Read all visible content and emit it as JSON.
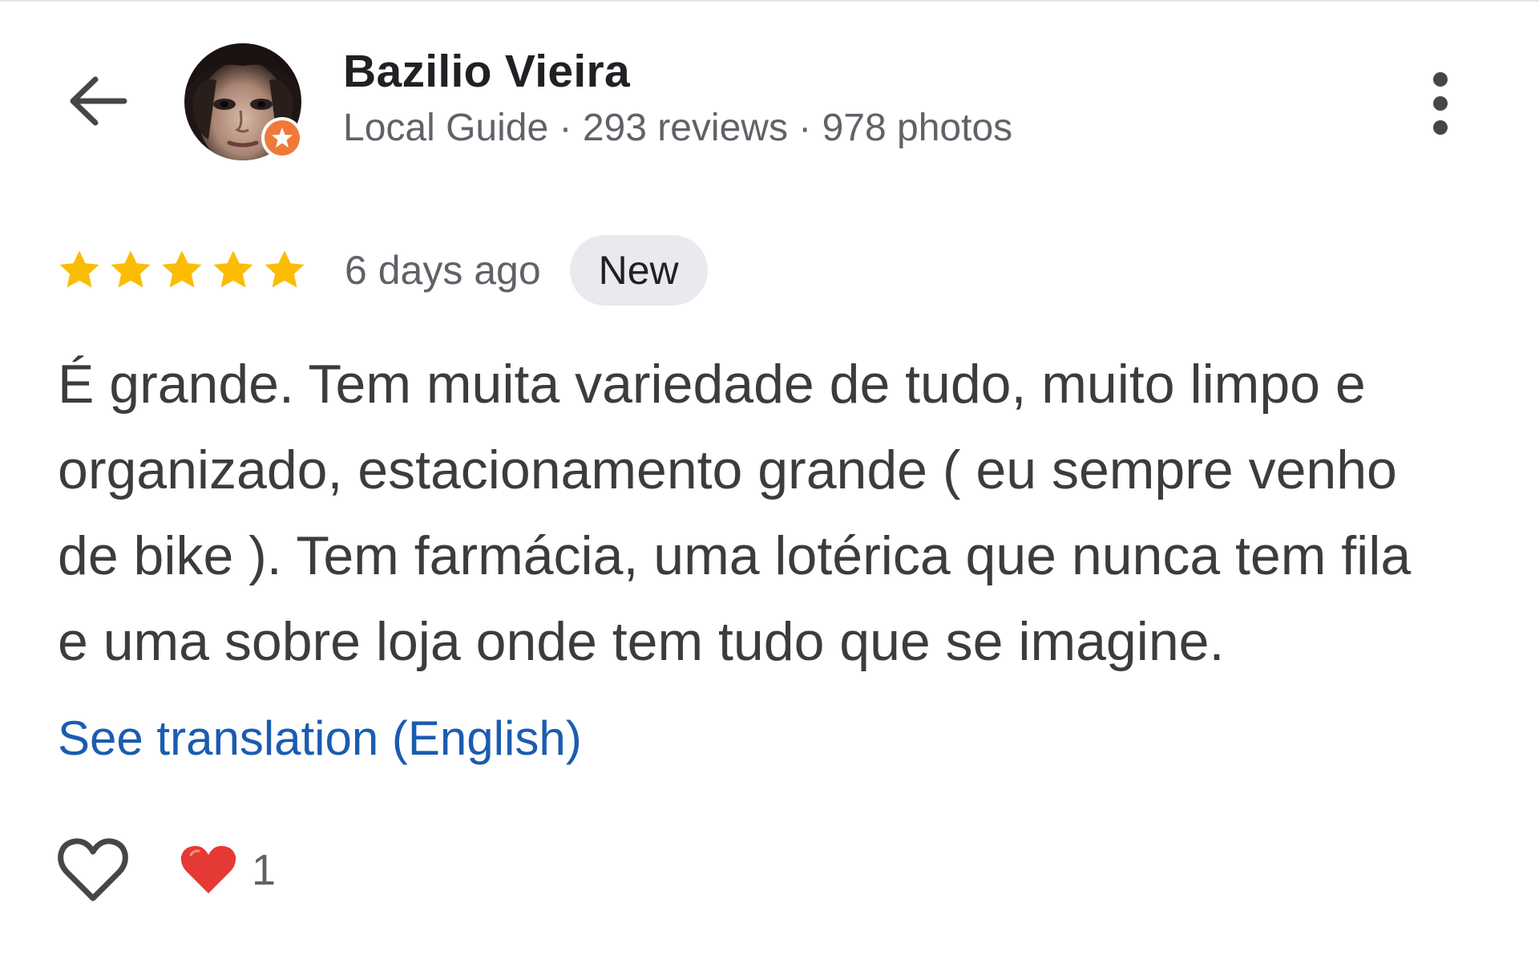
{
  "header": {
    "back_icon": "arrow-back-icon",
    "reviewer_name": "Bazilio Vieira",
    "reviewer_meta": "Local Guide · 293 reviews · 978 photos",
    "more_icon": "more-vert-icon",
    "avatar_badge_icon": "local-guide-star-badge-icon",
    "badge_color": "#f0793a"
  },
  "review": {
    "rating": 5,
    "rating_max": 5,
    "star_color": "#fbbc04",
    "date": "6 days ago",
    "badge": "New",
    "text_lines": [
      "É grande. Tem muita variedade de tudo, muito limpo e",
      "organizado, estacionamento grande ( eu sempre venho",
      "de bike ). Tem farmácia, uma lotérica que nunca tem fila",
      "e uma sobre loja onde tem tudo que se imagine."
    ],
    "translate_link": "See translation (English)",
    "link_color": "#1a5cb0"
  },
  "actions": {
    "like_icon": "heart-outline-icon",
    "reaction_icon": "red-heart-icon",
    "reaction_count": "1",
    "reaction_color": "#e53935"
  }
}
